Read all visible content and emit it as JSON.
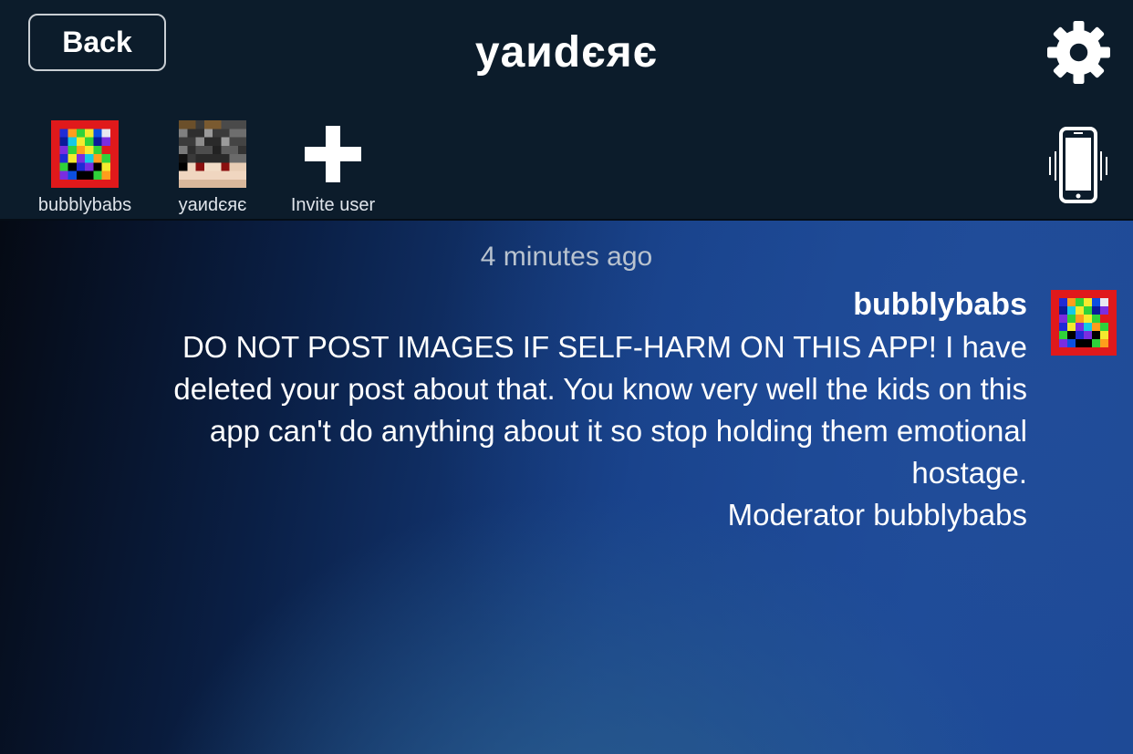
{
  "header": {
    "back_label": "Back",
    "title": "yаиdєяє"
  },
  "members": [
    {
      "name": "bubblybabs"
    },
    {
      "name": "yаиdєяє"
    },
    {
      "name": "Invite user"
    }
  ],
  "message": {
    "timestamp": "4 minutes ago",
    "author": "bubblybabs",
    "lines": [
      "DO NOT POST IMAGES IF SELF-HARM ON THIS APP!  I have",
      "deleted your post about that.  You know very well the kids on this",
      "app can't do anything about it so stop holding them emotional",
      "hostage.",
      "Moderator bubblybabs"
    ]
  }
}
